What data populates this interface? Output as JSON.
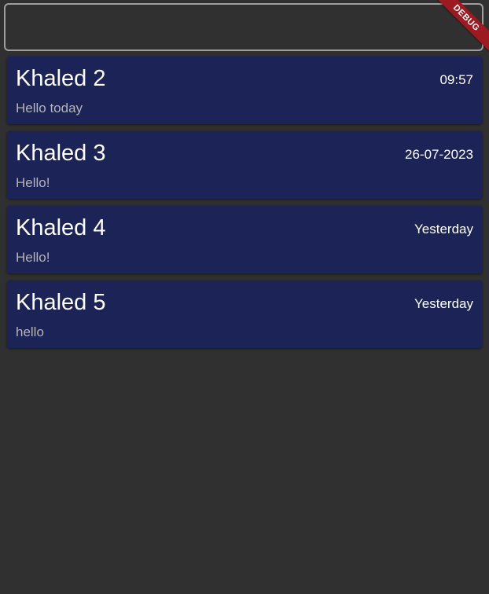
{
  "search": {
    "value": "",
    "placeholder": ""
  },
  "debug_banner": {
    "label": "DEBUG",
    "color": "#9c1a20"
  },
  "colors": {
    "background": "#303030",
    "card": "#1c2356",
    "message_text": "#b5b5b5"
  },
  "chats": [
    {
      "name": "Khaled 2",
      "time": "09:57",
      "message": "Hello today"
    },
    {
      "name": "Khaled 3",
      "time": "26-07-2023",
      "message": "Hello!"
    },
    {
      "name": "Khaled 4",
      "time": "Yesterday",
      "message": "Hello!"
    },
    {
      "name": "Khaled 5",
      "time": "Yesterday",
      "message": "hello"
    }
  ]
}
